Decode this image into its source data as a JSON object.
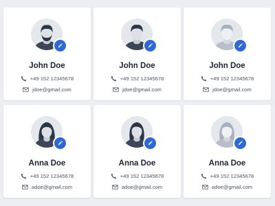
{
  "colors": {
    "background": "#eceef2",
    "card": "#ffffff",
    "accent": "#2f69d6",
    "avatar_bg": "#e4e7ec",
    "text_dark": "#1d2432"
  },
  "icons": {
    "phone": "phone-icon",
    "email": "envelope-icon",
    "edit": "pencil-icon"
  },
  "contacts": [
    {
      "name": "John Doe",
      "phone": "+49 152 12345678",
      "email": "jdoe@gmail.com"
    },
    {
      "name": "John Doe",
      "phone": "+49 152 12345678",
      "email": "jdoe@gmail.com"
    },
    {
      "name": "John Doe",
      "phone": "+49 152 12345678",
      "email": "jdoe@gmail.com"
    },
    {
      "name": "Anna Doe",
      "phone": "+49 152 12345678",
      "email": "adoe@gmail.com"
    },
    {
      "name": "Anna Doe",
      "phone": "+49 152 12345678",
      "email": "adoe@gmail.com"
    },
    {
      "name": "Anna Doe",
      "phone": "+49 152 12345678",
      "email": "adoe@gmail.com"
    }
  ]
}
